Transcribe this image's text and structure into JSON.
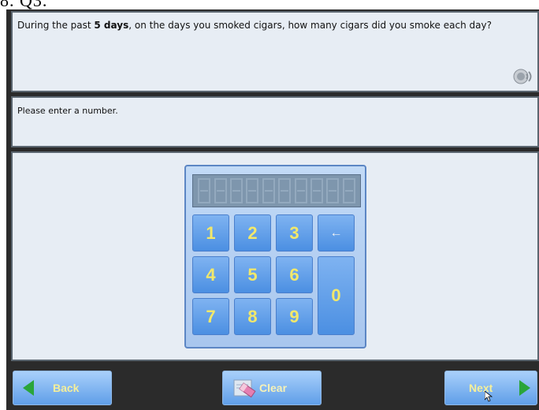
{
  "question": {
    "text_before": "During the past ",
    "bold": "5 days",
    "text_after": ", on the days you smoked cigars, how many cigars did you smoke each day?"
  },
  "instruction": "Please enter a number.",
  "keypad": {
    "keys": [
      "1",
      "2",
      "3",
      "←",
      "4",
      "5",
      "6",
      "0",
      "7",
      "8",
      "9"
    ]
  },
  "nav": {
    "back_label": "Back",
    "clear_label": "Clear",
    "next_label": "Next"
  },
  "icons": {
    "speaker": "speaker-icon",
    "eraser": "eraser-icon",
    "back_arrow": "arrow-left-icon",
    "next_arrow": "arrow-right-icon"
  },
  "colors": {
    "panel_bg": "#e7edf4",
    "key_text": "#f2e86a",
    "arrow_green": "#2aa53a",
    "frame": "#2b2b2b"
  }
}
